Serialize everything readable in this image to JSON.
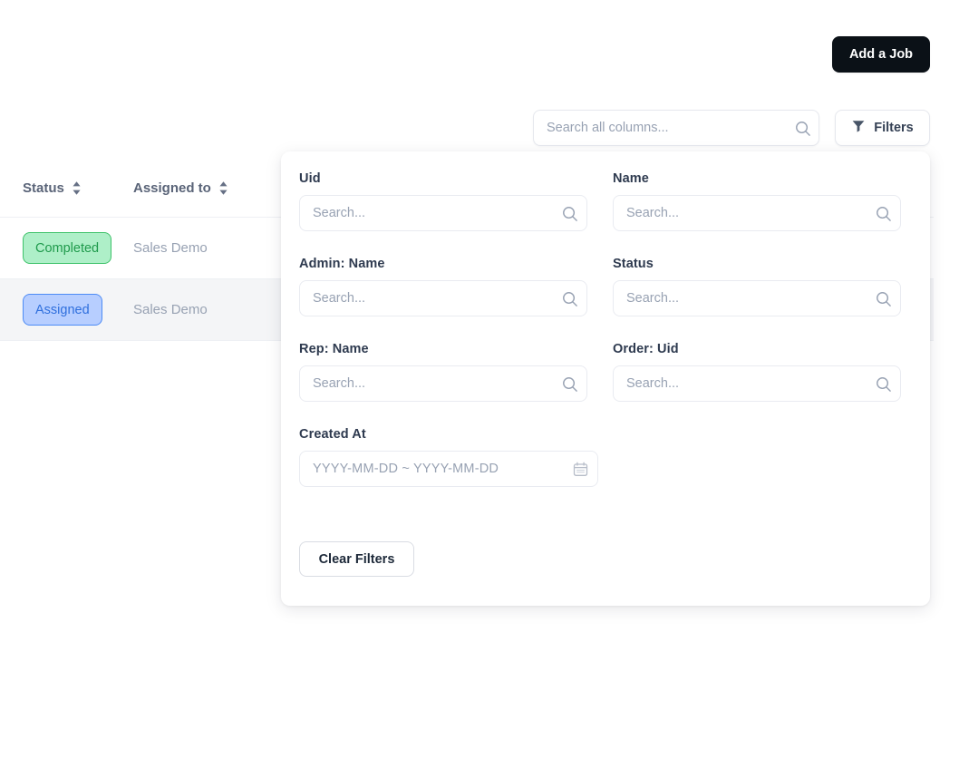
{
  "toolbar": {
    "add_job_label": "Add a Job",
    "search": {
      "value": "",
      "placeholder": "Search all columns..."
    },
    "filters_label": "Filters"
  },
  "table": {
    "columns": [
      {
        "label": "Status",
        "sortable": true
      },
      {
        "label": "Assigned to",
        "sortable": true
      }
    ],
    "rows": [
      {
        "status": "Completed",
        "status_variant": "green",
        "assigned_to": "Sales Demo"
      },
      {
        "status": "Assigned",
        "status_variant": "blue",
        "assigned_to": "Sales Demo"
      }
    ]
  },
  "filters_panel": {
    "fields": [
      {
        "label": "Uid",
        "value": "",
        "placeholder": "Search..."
      },
      {
        "label": "Name",
        "value": "",
        "placeholder": "Search..."
      },
      {
        "label": "Admin: Name",
        "value": "",
        "placeholder": "Search..."
      },
      {
        "label": "Status",
        "value": "",
        "placeholder": "Search..."
      },
      {
        "label": "Rep: Name",
        "value": "",
        "placeholder": "Search..."
      },
      {
        "label": "Order: Uid",
        "value": "",
        "placeholder": "Search..."
      },
      {
        "label": "Created At",
        "value": "",
        "placeholder": "YYYY-MM-DD ~ YYYY-MM-DD"
      }
    ],
    "clear_filters_label": "Clear Filters"
  },
  "colors": {
    "add_job_bg": "#0b1117",
    "badge_completed_bg": "#aeefc8",
    "badge_completed_text": "#1f9a4c",
    "badge_assigned_bg": "#b7ceff",
    "badge_assigned_text": "#2f6fdd",
    "label_text": "#2e3a4f",
    "placeholder_text": "#98a2b3"
  }
}
